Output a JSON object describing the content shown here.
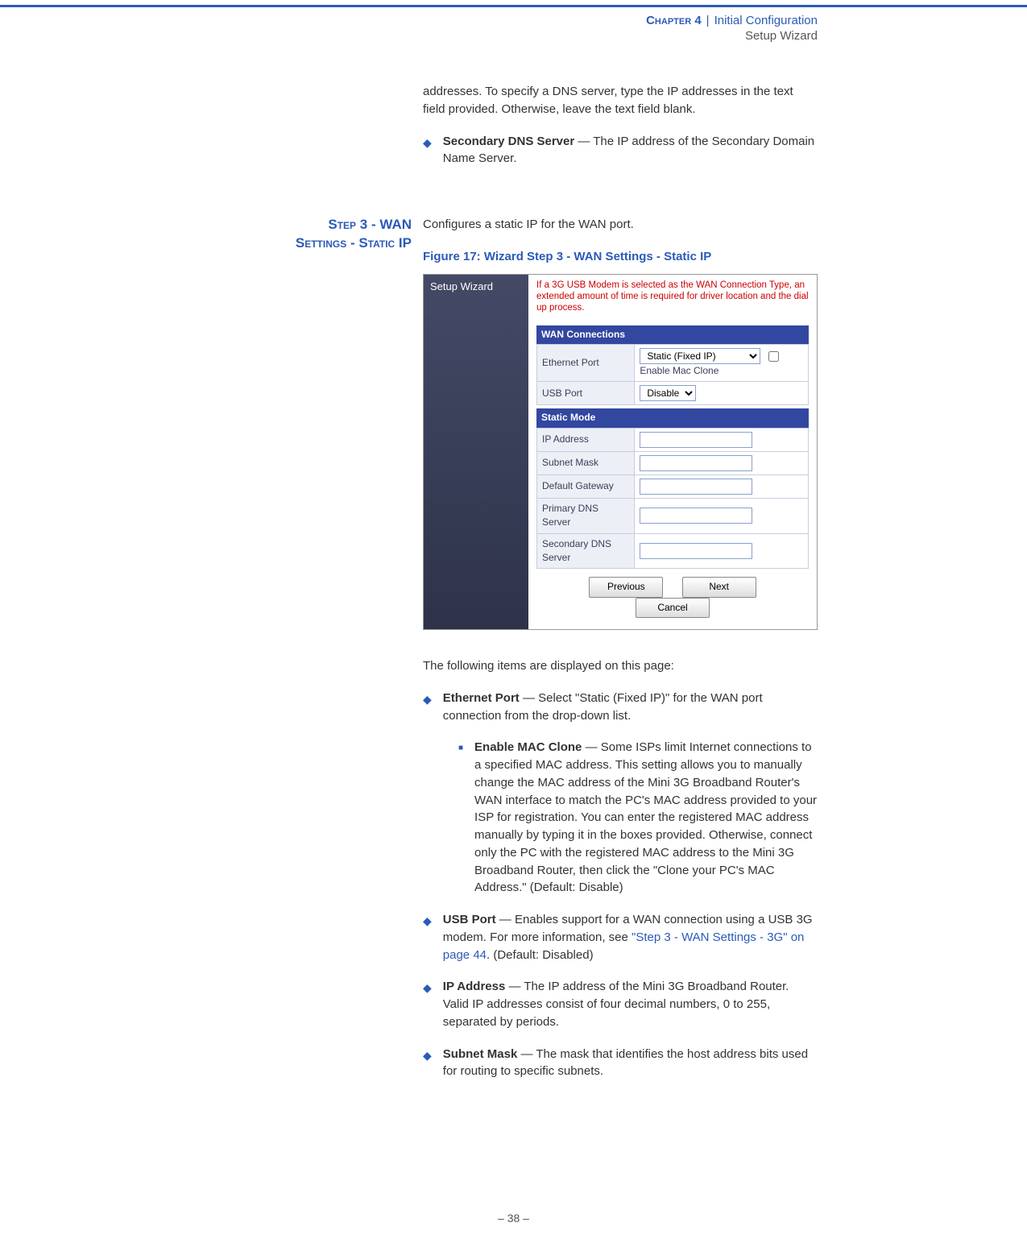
{
  "header": {
    "chapter": "Chapter 4",
    "title": "Initial Configuration",
    "subtitle": "Setup Wizard"
  },
  "intro_continuation": "addresses. To specify a DNS server, type the IP addresses in the text field provided. Otherwise, leave the text field blank.",
  "bullets_top": {
    "secondary_dns": {
      "term": "Secondary DNS Server",
      "text": " — The IP address of the Secondary Domain Name Server."
    }
  },
  "section": {
    "side_label_line1": "Step 3 - WAN",
    "side_label_line2": "Settings - Static IP",
    "intro": "Configures a static IP for the WAN port.",
    "figure_caption": "Figure 17:  Wizard Step 3 - WAN Settings - Static IP",
    "following_items": "The following items are displayed on this page:"
  },
  "bullets_main": [
    {
      "term": "Ethernet Port",
      "text": " — Select \"Static (Fixed IP)\" for the WAN port connection from the drop-down list.",
      "sub": {
        "term": "Enable MAC Clone",
        "text": " — Some ISPs limit Internet connections to a specified MAC address. This setting allows you to manually change the MAC address of the Mini 3G Broadband Router's WAN interface to match the PC's MAC address provided to your ISP for registration. You can enter the registered MAC address manually by typing it in the boxes provided. Otherwise, connect only the PC with the registered MAC address to the Mini 3G Broadband Router, then click the \"Clone your PC's MAC Address.\" (Default: Disable)"
      }
    },
    {
      "term": "USB Port",
      "text_before": " — Enables support for a WAN connection using a USB 3G modem. For more information, see ",
      "link": "\"Step 3 - WAN Settings - 3G\" on page 44",
      "text_after": ". (Default: Disabled)"
    },
    {
      "term": "IP Address",
      "text": " — The IP address of the Mini 3G Broadband Router. Valid IP addresses consist of four decimal numbers, 0 to 255, separated by periods."
    },
    {
      "term": "Subnet Mask",
      "text": " — The mask that identifies the host address bits used for routing to specific subnets."
    }
  ],
  "footer_page": "–  38  –",
  "screenshot": {
    "side_label": "Setup Wizard",
    "warning": "If a 3G USB Modem is selected as the WAN Connection Type, an extended amount of time is required for driver location and the dial up process.",
    "wan_conn_header": "WAN Connections",
    "rows_wan": {
      "ethernet_label": "Ethernet Port",
      "ethernet_select": "Static (Fixed IP)",
      "enable_mac": "Enable Mac Clone",
      "usb_label": "USB Port",
      "usb_select": "Disable"
    },
    "static_header": "Static Mode",
    "rows_static": {
      "ip": "IP Address",
      "subnet": "Subnet Mask",
      "gateway": "Default Gateway",
      "pdns": "Primary DNS Server",
      "sdns": "Secondary DNS Server"
    },
    "btn_prev": "Previous",
    "btn_next": "Next",
    "btn_cancel": "Cancel"
  }
}
